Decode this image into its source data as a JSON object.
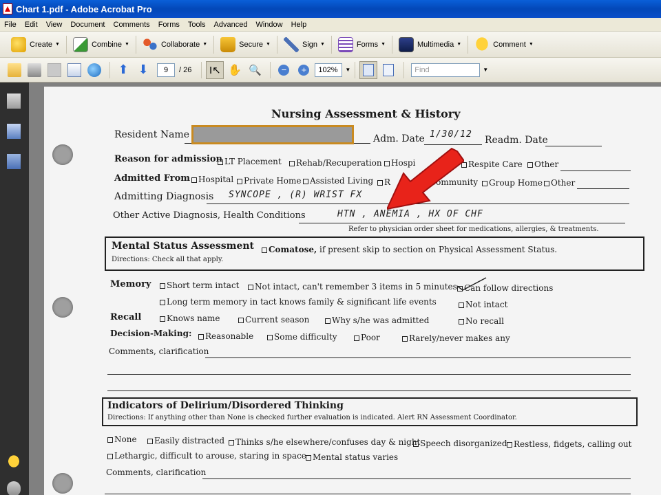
{
  "window": {
    "title": "Chart 1.pdf - Adobe Acrobat Pro"
  },
  "menubar": {
    "items": [
      "File",
      "Edit",
      "View",
      "Document",
      "Comments",
      "Forms",
      "Tools",
      "Advanced",
      "Window",
      "Help"
    ]
  },
  "toolbar1": {
    "create": "Create",
    "combine": "Combine",
    "collaborate": "Collaborate",
    "secure": "Secure",
    "sign": "Sign",
    "forms": "Forms",
    "multimedia": "Multimedia",
    "comment": "Comment"
  },
  "toolbar2": {
    "page_current": "9",
    "page_total": "/ 26",
    "zoom": "102%",
    "find_placeholder": "Find"
  },
  "colors": {
    "titlebar": "#0a4fc9",
    "arrow": "#e8231a",
    "redaction_border": "#c98a20"
  },
  "form": {
    "title": "Nursing Assessment & History",
    "resident_name": "Resident Name",
    "adm_date_label": "Adm. Date",
    "adm_date_value": "1/30/12",
    "readm_date_label": "Readm. Date",
    "reason_label": "Reason for admission",
    "reason_opts": [
      "LT Placement",
      "Rehab/Recuperation",
      "Hospi",
      "Respite Care",
      "Other"
    ],
    "admitted_from_label": "Admitted From",
    "admitted_opts": [
      "Hospital",
      "Private Home",
      "Assisted Living",
      "R",
      "Community",
      "Group Home",
      "Other"
    ],
    "admitting_dx_label": "Admitting Diagnosis",
    "admitting_dx_value": "SYNCOPE , (R)  WRIST FX",
    "other_dx_label": "Other Active Diagnosis, Health Conditions",
    "other_dx_value": "HTN , ANEMIA ,  HX OF CHF",
    "refer_note": "Refer to physician order sheet for medications, allergies, & treatments.",
    "mental_title": "Mental Status Assessment",
    "comatose": "Comatose,",
    "comatose_rest": "if present skip to section on Physical Assessment Status.",
    "mental_directions": "Directions:  Check all that apply.",
    "memory_label": "Memory",
    "memory_opts": [
      "Short term intact",
      "Not intact, can't remember 3 items in 5 minutes",
      "Can follow directions"
    ],
    "memory_row2": [
      "Long term memory in tact knows family & significant life events",
      "Not intact"
    ],
    "recall_label": "Recall",
    "recall_opts": [
      "Knows name",
      "Current season",
      "Why s/he was admitted",
      "No recall"
    ],
    "decision_label": "Decision-Making:",
    "decision_opts": [
      "Reasonable",
      "Some difficulty",
      "Poor",
      "Rarely/never makes any"
    ],
    "comments_label": "Comments, clarification",
    "delirium_title": "Indicators of Delirium/Disordered Thinking",
    "delirium_directions": "Directions:  If anything other than None is checked further evaluation is indicated.  Alert RN Assessment Coordinator.",
    "delirium_opts": [
      "None",
      "Easily distracted",
      "Thinks s/he elsewhere/confuses day & night",
      "Speech disorganized",
      "Restless, fidgets, calling out"
    ],
    "delirium_row2": [
      "Lethargic, difficult to arouse, staring in space",
      "Mental status varies"
    ],
    "comments2_label": "Comments, clarification"
  }
}
